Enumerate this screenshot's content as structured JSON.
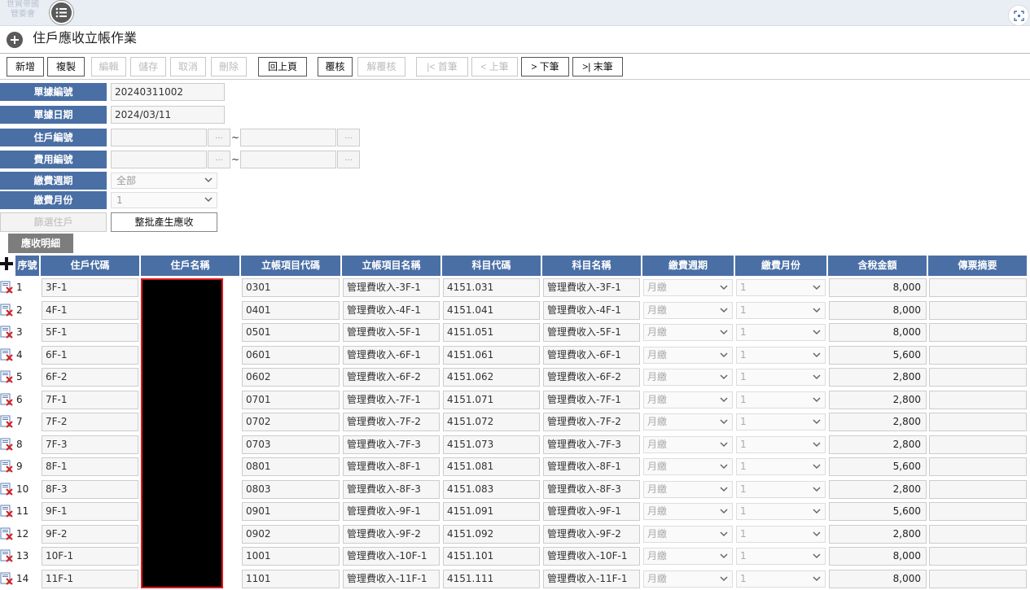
{
  "app": {
    "logo_text": "世貿帝國 管委會"
  },
  "page": {
    "title": "住戶應收立帳作業"
  },
  "toolbar": {
    "buttons": [
      {
        "label": "新增",
        "enabled": true
      },
      {
        "label": "複製",
        "enabled": true
      },
      {
        "label": "編輯",
        "enabled": false
      },
      {
        "label": "儲存",
        "enabled": false
      },
      {
        "label": "取消",
        "enabled": false
      },
      {
        "label": "刪除",
        "enabled": false
      },
      {
        "label": "回上頁",
        "enabled": true
      },
      {
        "label": "覆核",
        "enabled": true
      },
      {
        "label": "解覆核",
        "enabled": false
      },
      {
        "label": "|< 首筆",
        "enabled": false
      },
      {
        "label": "< 上筆",
        "enabled": false
      },
      {
        "label": "> 下筆",
        "enabled": true
      },
      {
        "label": ">| 末筆",
        "enabled": true
      }
    ]
  },
  "form": {
    "doc_no_label": "單據編號",
    "doc_no": "20240311002",
    "doc_date_label": "單據日期",
    "doc_date": "2024/03/11",
    "resident_no_label": "住戶編號",
    "fee_no_label": "費用編號",
    "range_sep": "~",
    "lookup_label": "...",
    "pay_cycle_label": "繳費週期",
    "pay_cycle_value": "全部",
    "pay_month_label": "繳費月份",
    "pay_month_value": "1",
    "select_resident_button": "篩選住戶",
    "batch_generate_button": "整批產生應收"
  },
  "detail": {
    "tab_label": "應收明細",
    "columns": [
      "序號",
      "住戶代碼",
      "住戶名稱",
      "立帳項目代碼",
      "立帳項目名稱",
      "科目代碼",
      "科目名稱",
      "繳費週期",
      "繳費月份",
      "含稅金額",
      "傳票摘要"
    ],
    "rows": [
      {
        "seq": "1",
        "resident_code": "3F-1",
        "item_code": "0301",
        "item_name": "管理費收入-3F-1",
        "account_code": "4151.031",
        "account_name": "管理費收入-3F-1",
        "cycle": "月繳",
        "month": "1",
        "amount": "8,000"
      },
      {
        "seq": "2",
        "resident_code": "4F-1",
        "item_code": "0401",
        "item_name": "管理費收入-4F-1",
        "account_code": "4151.041",
        "account_name": "管理費收入-4F-1",
        "cycle": "月繳",
        "month": "1",
        "amount": "8,000"
      },
      {
        "seq": "3",
        "resident_code": "5F-1",
        "item_code": "0501",
        "item_name": "管理費收入-5F-1",
        "account_code": "4151.051",
        "account_name": "管理費收入-5F-1",
        "cycle": "月繳",
        "month": "1",
        "amount": "8,000"
      },
      {
        "seq": "4",
        "resident_code": "6F-1",
        "item_code": "0601",
        "item_name": "管理費收入-6F-1",
        "account_code": "4151.061",
        "account_name": "管理費收入-6F-1",
        "cycle": "月繳",
        "month": "1",
        "amount": "5,600"
      },
      {
        "seq": "5",
        "resident_code": "6F-2",
        "item_code": "0602",
        "item_name": "管理費收入-6F-2",
        "account_code": "4151.062",
        "account_name": "管理費收入-6F-2",
        "cycle": "月繳",
        "month": "1",
        "amount": "2,800"
      },
      {
        "seq": "6",
        "resident_code": "7F-1",
        "item_code": "0701",
        "item_name": "管理費收入-7F-1",
        "account_code": "4151.071",
        "account_name": "管理費收入-7F-1",
        "cycle": "月繳",
        "month": "1",
        "amount": "2,800"
      },
      {
        "seq": "7",
        "resident_code": "7F-2",
        "item_code": "0702",
        "item_name": "管理費收入-7F-2",
        "account_code": "4151.072",
        "account_name": "管理費收入-7F-2",
        "cycle": "月繳",
        "month": "1",
        "amount": "2,800"
      },
      {
        "seq": "8",
        "resident_code": "7F-3",
        "item_code": "0703",
        "item_name": "管理費收入-7F-3",
        "account_code": "4151.073",
        "account_name": "管理費收入-7F-3",
        "cycle": "月繳",
        "month": "1",
        "amount": "2,800"
      },
      {
        "seq": "9",
        "resident_code": "8F-1",
        "item_code": "0801",
        "item_name": "管理費收入-8F-1",
        "account_code": "4151.081",
        "account_name": "管理費收入-8F-1",
        "cycle": "月繳",
        "month": "1",
        "amount": "5,600"
      },
      {
        "seq": "10",
        "resident_code": "8F-3",
        "item_code": "0803",
        "item_name": "管理費收入-8F-3",
        "account_code": "4151.083",
        "account_name": "管理費收入-8F-3",
        "cycle": "月繳",
        "month": "1",
        "amount": "2,800"
      },
      {
        "seq": "11",
        "resident_code": "9F-1",
        "item_code": "0901",
        "item_name": "管理費收入-9F-1",
        "account_code": "4151.091",
        "account_name": "管理費收入-9F-1",
        "cycle": "月繳",
        "month": "1",
        "amount": "5,600"
      },
      {
        "seq": "12",
        "resident_code": "9F-2",
        "item_code": "0902",
        "item_name": "管理費收入-9F-2",
        "account_code": "4151.092",
        "account_name": "管理費收入-9F-2",
        "cycle": "月繳",
        "month": "1",
        "amount": "2,800"
      },
      {
        "seq": "13",
        "resident_code": "10F-1",
        "item_code": "1001",
        "item_name": "管理費收入-10F-1",
        "account_code": "4151.101",
        "account_name": "管理費收入-10F-1",
        "cycle": "月繳",
        "month": "1",
        "amount": "8,000"
      },
      {
        "seq": "14",
        "resident_code": "11F-1",
        "item_code": "1101",
        "item_name": "管理費收入-11F-1",
        "account_code": "4151.111",
        "account_name": "管理費收入-11F-1",
        "cycle": "月繳",
        "month": "1",
        "amount": "8,000"
      }
    ]
  },
  "colors": {
    "header_blue": "#4a6fa5",
    "tab_gray": "#7d7d7d",
    "redaction_border": "#e0161d"
  },
  "icons": {
    "menu": "list-menu-icon",
    "title": "plus-circle-icon",
    "add_row": "plus-icon",
    "row_delete": "delete-row-icon",
    "focus": "focus-icon"
  }
}
